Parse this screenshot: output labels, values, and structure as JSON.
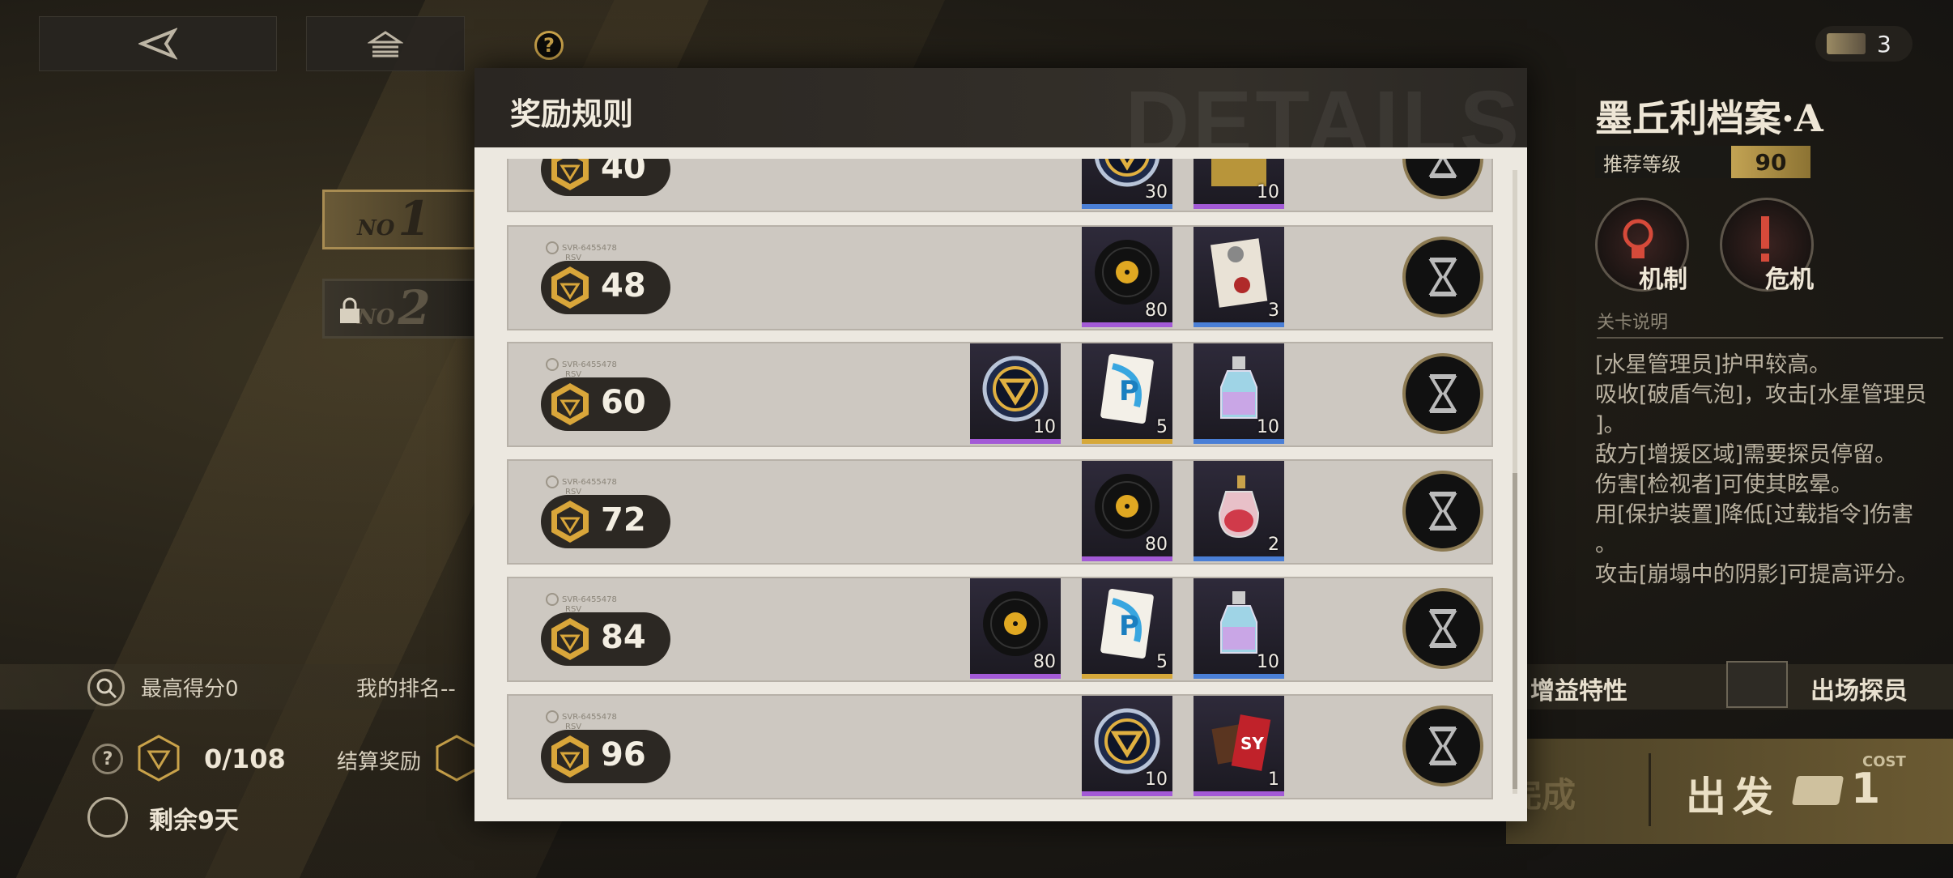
{
  "nav": {
    "back_icon": "back-arrow-icon",
    "home_icon": "home-icon",
    "help_label": "?"
  },
  "currency": {
    "count": "3"
  },
  "stages": [
    {
      "no": "NO",
      "num": "1",
      "locked": false
    },
    {
      "no": "NO",
      "num": "2",
      "locked": true
    }
  ],
  "left": {
    "best_score": "最高得分0",
    "my_rank": "我的排名--",
    "progress": "0/108",
    "settle_reward": "结算奖励",
    "remaining": "剩余9天",
    "help": "?"
  },
  "stage_info": {
    "title": "墨丘利档案·A",
    "level_label": "推荐等级",
    "level_value": "90",
    "features": [
      {
        "label": "机制"
      },
      {
        "label": "危机"
      }
    ],
    "section_title": "关卡说明",
    "desc": [
      "[水星管理员]护甲较高。",
      "吸收[破盾气泡]，攻击[水星管理员",
      "]。",
      "敌方[增援区域]需要探员停留。",
      "伤害[检视者]可使其眩晕。",
      "用[保护装置]降低[过载指令]伤害",
      "。",
      "攻击[崩塌中的阴影]可提高评分。"
    ]
  },
  "bottom_right": {
    "buff_label": "增益特性",
    "agents_label": "出场探员",
    "faded_label": "完成",
    "go_label": "出发",
    "cost_label": "COST",
    "cost_value": "1"
  },
  "modal": {
    "title": "奖励规则",
    "watermark": "DETAILS",
    "code_text_1": "SVR-6455478",
    "code_text_2": "RSV",
    "rows": [
      {
        "score": "40",
        "items": [
          {
            "icon": "badge-coin-icon",
            "count": "30",
            "rarity": "blue"
          },
          {
            "icon": "record-pack-icon",
            "count": "10",
            "rarity": "purple"
          }
        ]
      },
      {
        "score": "48",
        "items": [
          {
            "icon": "vinyl-record-icon",
            "count": "80",
            "rarity": "purple"
          },
          {
            "icon": "document-seal-icon",
            "count": "3",
            "rarity": "blue"
          }
        ]
      },
      {
        "score": "60",
        "items": [
          {
            "icon": "badge-coin-icon",
            "count": "10",
            "rarity": "purple"
          },
          {
            "icon": "p-card-icon",
            "count": "5",
            "rarity": "gold"
          },
          {
            "icon": "potion-bottle-icon",
            "count": "10",
            "rarity": "blue"
          }
        ]
      },
      {
        "score": "72",
        "items": [
          {
            "icon": "vinyl-record-icon",
            "count": "80",
            "rarity": "purple"
          },
          {
            "icon": "perfume-bottle-icon",
            "count": "2",
            "rarity": "blue"
          }
        ]
      },
      {
        "score": "84",
        "items": [
          {
            "icon": "vinyl-record-icon",
            "count": "80",
            "rarity": "purple"
          },
          {
            "icon": "p-card-icon",
            "count": "5",
            "rarity": "gold"
          },
          {
            "icon": "potion-bottle-icon",
            "count": "10",
            "rarity": "blue"
          }
        ]
      },
      {
        "score": "96",
        "items": [
          {
            "icon": "badge-coin-icon",
            "count": "10",
            "rarity": "purple"
          },
          {
            "icon": "chocolate-bar-icon",
            "count": "1",
            "rarity": "purple"
          }
        ]
      }
    ]
  }
}
